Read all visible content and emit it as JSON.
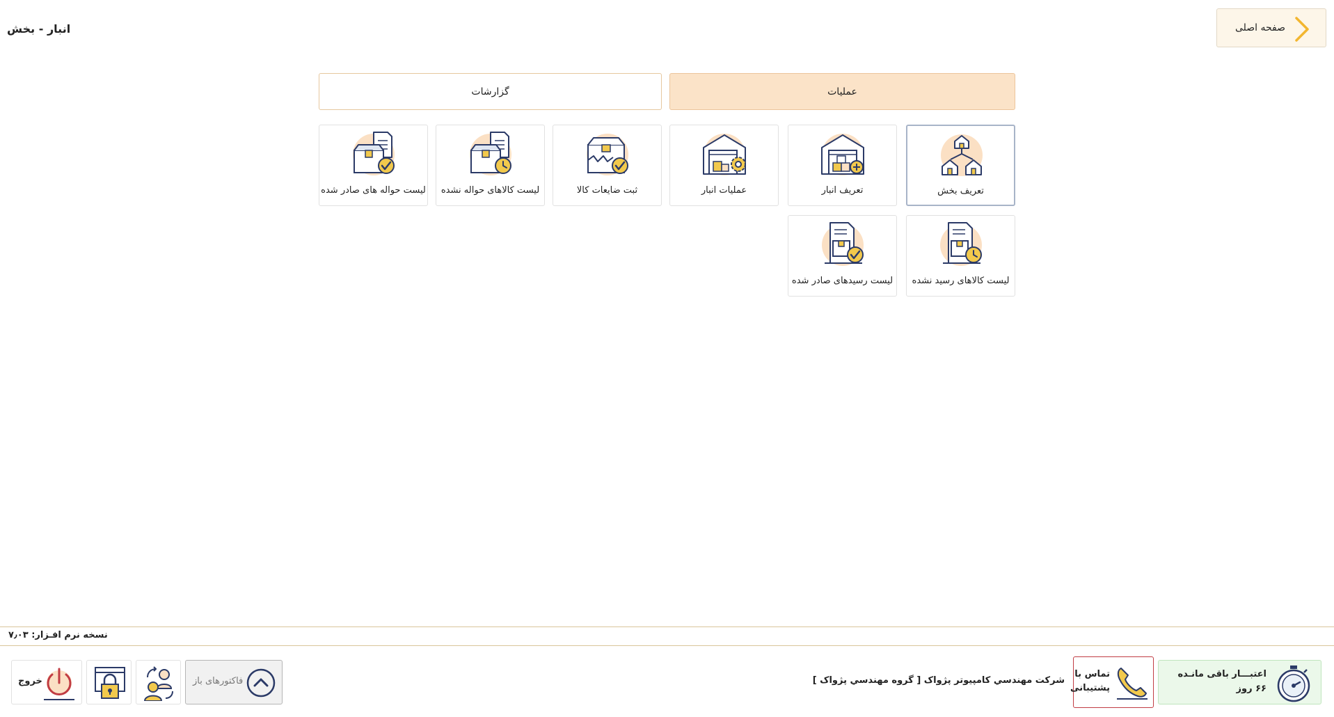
{
  "header": {
    "title": "انبار - بخش",
    "home_label": "صفحه اصلی"
  },
  "tabs": [
    {
      "label": "عملیات",
      "active": true
    },
    {
      "label": "گزارشات",
      "active": false
    }
  ],
  "tiles": [
    {
      "label": "تعریف بخش",
      "icon": "houses-network-icon",
      "selected": true
    },
    {
      "label": "تعریف انبار",
      "icon": "warehouse-add-icon"
    },
    {
      "label": "عملیات انبار",
      "icon": "warehouse-gear-icon"
    },
    {
      "label": "ثبت ضایعات کالا",
      "icon": "damaged-box-check-icon"
    },
    {
      "label": "لیست کالاهای حواله نشده",
      "icon": "box-document-clock-icon"
    },
    {
      "label": "لیست حواله های صادر شده",
      "icon": "box-document-check-icon"
    },
    {
      "label": "لیست کالاهای رسید نشده",
      "icon": "receipt-box-clock-icon"
    },
    {
      "label": "لیست رسیدهای صادر شده",
      "icon": "receipt-box-check-icon"
    }
  ],
  "footer": {
    "version": "نسخه نرم افـزار: ۷٫۰۳",
    "credit_line1": "اعتبـــار باقی مانـده",
    "credit_line2": "۶۶ روز",
    "support_line1": "تماس با",
    "support_line2": "پشتیبانی",
    "company": "شرکت مهندسي کامپيوتر پژواک [ گروه مهندسي پژواک ]",
    "open_invoices": "فاکتورهای باز",
    "exit": "خروج"
  },
  "colors": {
    "accent_light": "#fbe3c8",
    "accent_border": "#e6c79e",
    "icon_navy": "#2b3a67",
    "icon_yellow": "#f2c94c",
    "icon_peach": "#fbe0c4",
    "credit_bg": "#ebf8ea",
    "support_border": "#c13c43"
  }
}
